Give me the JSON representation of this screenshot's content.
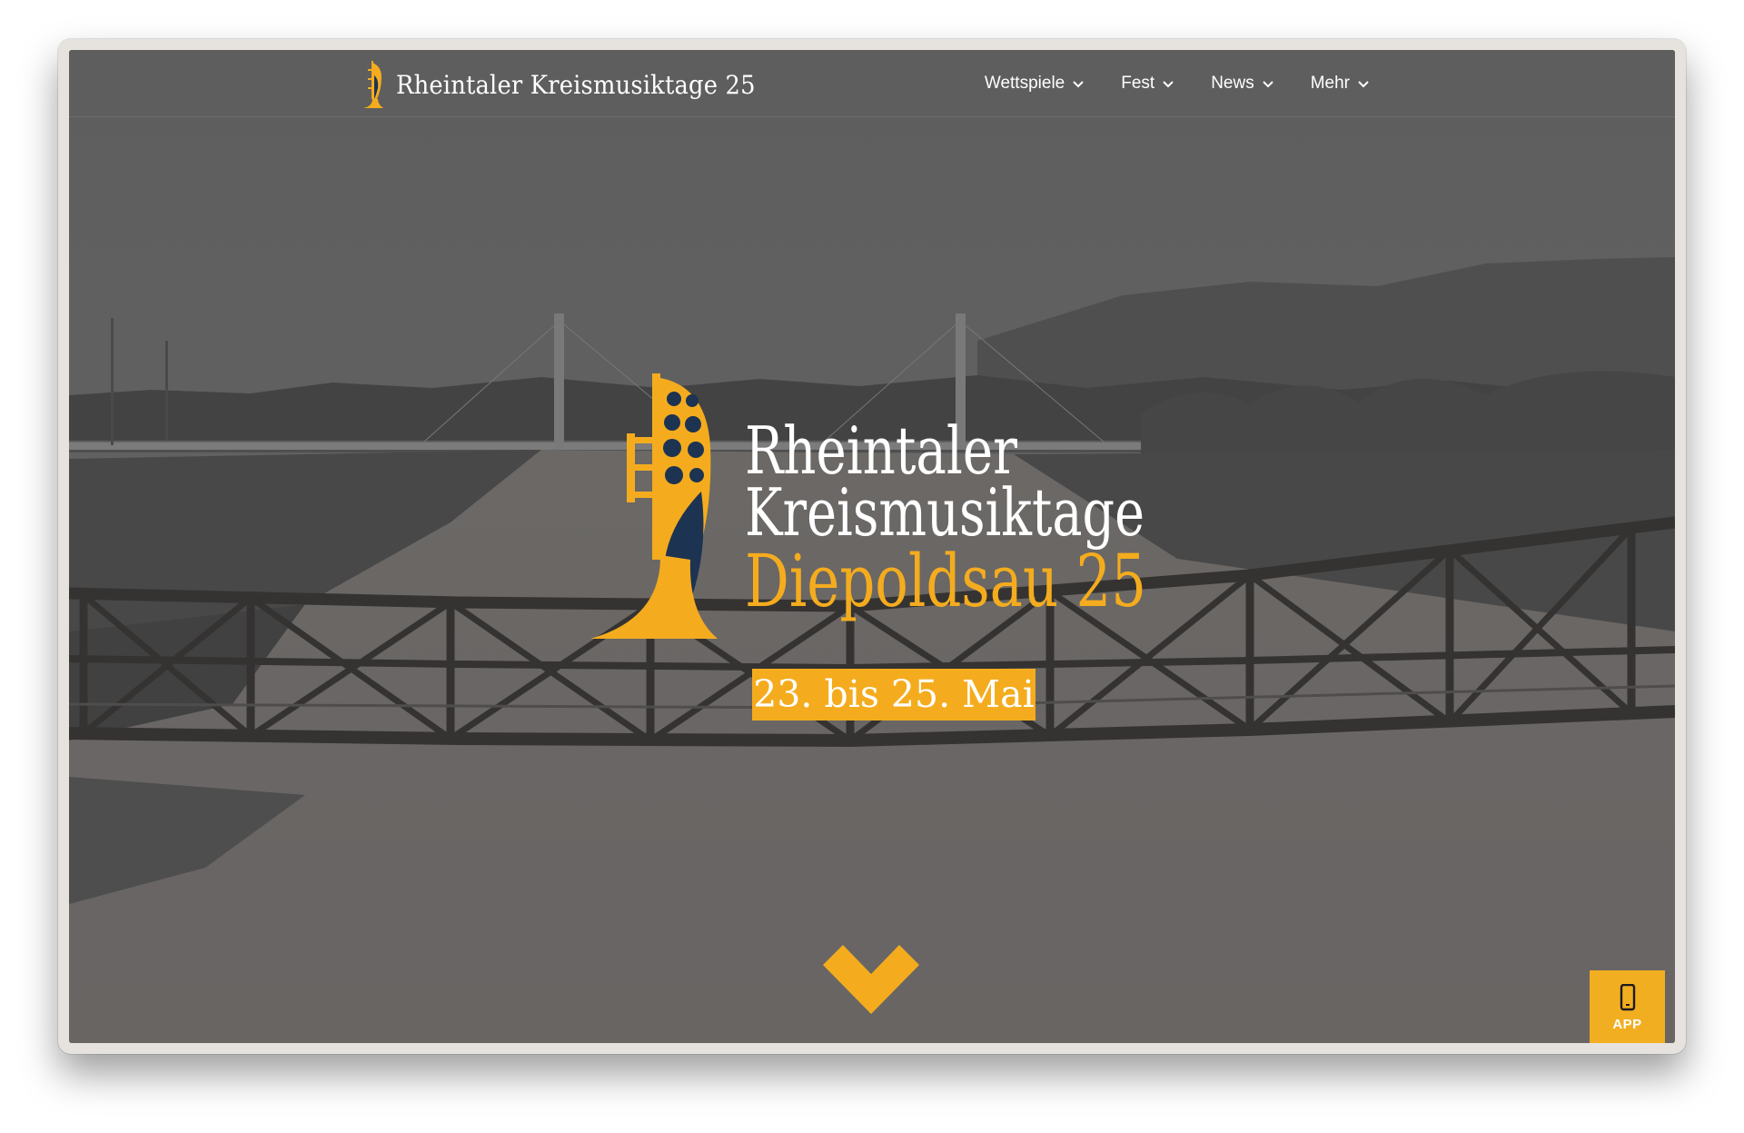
{
  "navbar": {
    "brand_name": "Rheintaler Kreismusiktage 25",
    "brand_icon": "trumpet-corn-icon",
    "menu": [
      {
        "label": "Wettspiele",
        "icon": "chevron-down-icon"
      },
      {
        "label": "Fest",
        "icon": "chevron-down-icon"
      },
      {
        "label": "News",
        "icon": "chevron-down-icon"
      },
      {
        "label": "Mehr",
        "icon": "chevron-down-icon"
      }
    ]
  },
  "hero": {
    "background": "grayscale-photo-bridge-over-river",
    "logo": {
      "line1": "Rheintaler",
      "line2": "Kreismusiktage",
      "line3": "Diepoldsau 25",
      "icon": "trumpet-corn-icon"
    },
    "date": "23. bis 25. Mai",
    "scroll_icon": "chevron-down-icon"
  },
  "app_button": {
    "label": "APP",
    "icon": "smartphone-icon"
  },
  "colors": {
    "accent": "#f4ac1e",
    "navy": "#1d3352",
    "text_light": "#ffffff",
    "overlay": "#6e6e6e"
  }
}
